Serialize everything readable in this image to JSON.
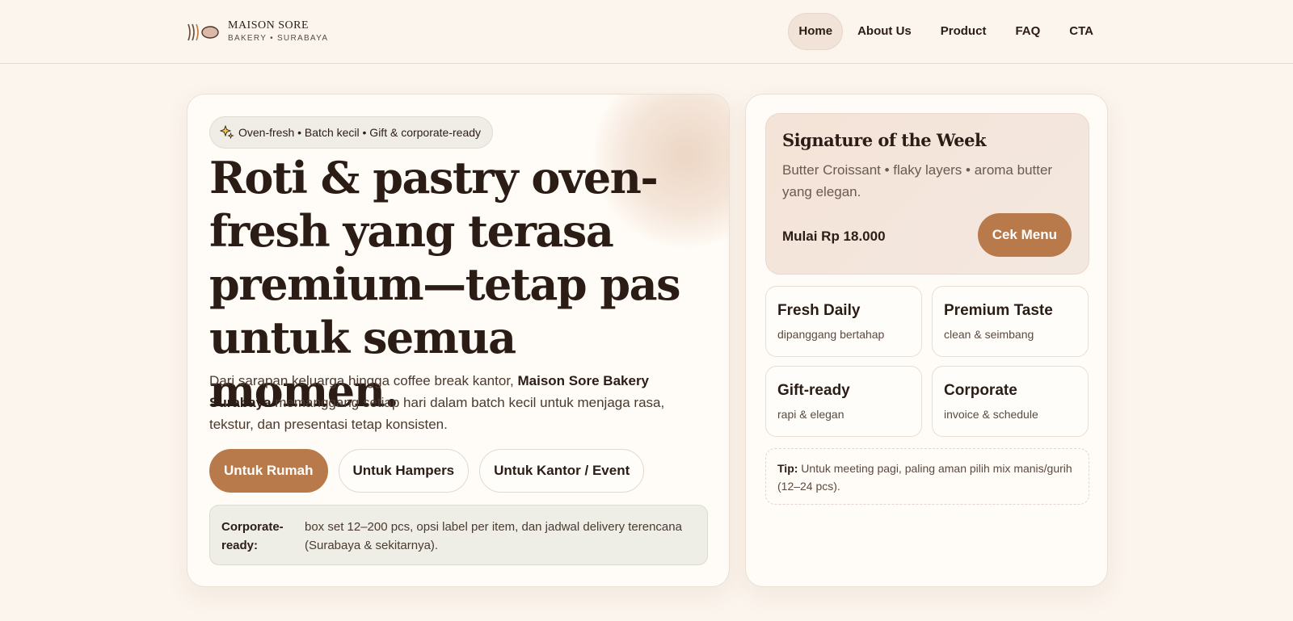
{
  "brand": {
    "name": "MAISON SORE",
    "tagline": "BAKERY • SURABAYA"
  },
  "nav": {
    "items": [
      {
        "label": "Home",
        "active": true
      },
      {
        "label": "About Us"
      },
      {
        "label": "Product"
      },
      {
        "label": "FAQ"
      },
      {
        "label": "CTA"
      }
    ]
  },
  "hero": {
    "pill": "Oven-fresh • Batch kecil • Gift & corporate-ready",
    "headline": "Roti & pastry oven-fresh yang terasa premium—tetap pas untuk semua momen.",
    "lead_before": "Dari sarapan keluarga hingga coffee break kantor, ",
    "lead_bold": "Maison Sore Bakery Surabaya",
    "lead_after": " memanggang setiap hari dalam batch kecil untuk menjaga rasa, tekstur, dan presentasi tetap konsisten.",
    "buttons": [
      "Untuk Rumah",
      "Untuk Hampers",
      "Untuk Kantor / Event"
    ],
    "note_label": "Corporate-ready:",
    "note_text": "box set 12–200 pcs, opsi label per item, dan jadwal delivery terencana (Surabaya & sekitarnya)."
  },
  "signature": {
    "title": "Signature of the Week",
    "description": "Butter Croissant • flaky layers • aroma butter yang elegan.",
    "price": "Mulai Rp 18.000",
    "button": "Cek Menu"
  },
  "features": [
    {
      "title": "Fresh Daily",
      "subtitle": "dipanggang bertahap"
    },
    {
      "title": "Premium Taste",
      "subtitle": "clean & seimbang"
    },
    {
      "title": "Gift-ready",
      "subtitle": "rapi & elegan"
    },
    {
      "title": "Corporate",
      "subtitle": "invoice & schedule"
    }
  ],
  "tip": {
    "label": "Tip:",
    "text": " Untuk meeting pagi, paling aman pilih mix manis/gurih (12–24 pcs)."
  },
  "colors": {
    "accent": "#b97a4b",
    "background": "#fcf5ed",
    "text": "#2b1d16"
  }
}
